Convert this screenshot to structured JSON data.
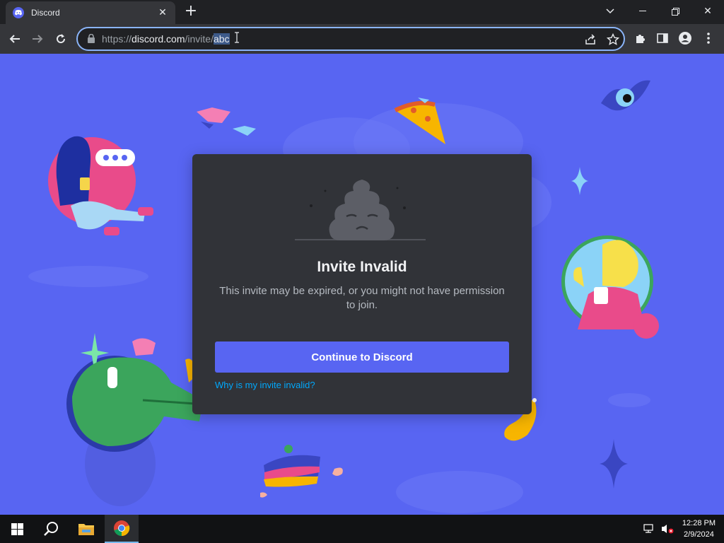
{
  "browser": {
    "tab_title": "Discord",
    "url_prefix": "https://",
    "url_domain": "discord.com",
    "url_path": "/invite/",
    "url_selected": "abc"
  },
  "card": {
    "title": "Invite Invalid",
    "description": "This invite may be expired, or you might not have permission to join.",
    "continue_label": "Continue to Discord",
    "why_link": "Why is my invite invalid?"
  },
  "taskbar": {
    "time": "12:28 PM",
    "date": "2/9/2024"
  },
  "colors": {
    "blurple": "#5865F2",
    "card_bg": "#313338",
    "link": "#00a8fc"
  }
}
